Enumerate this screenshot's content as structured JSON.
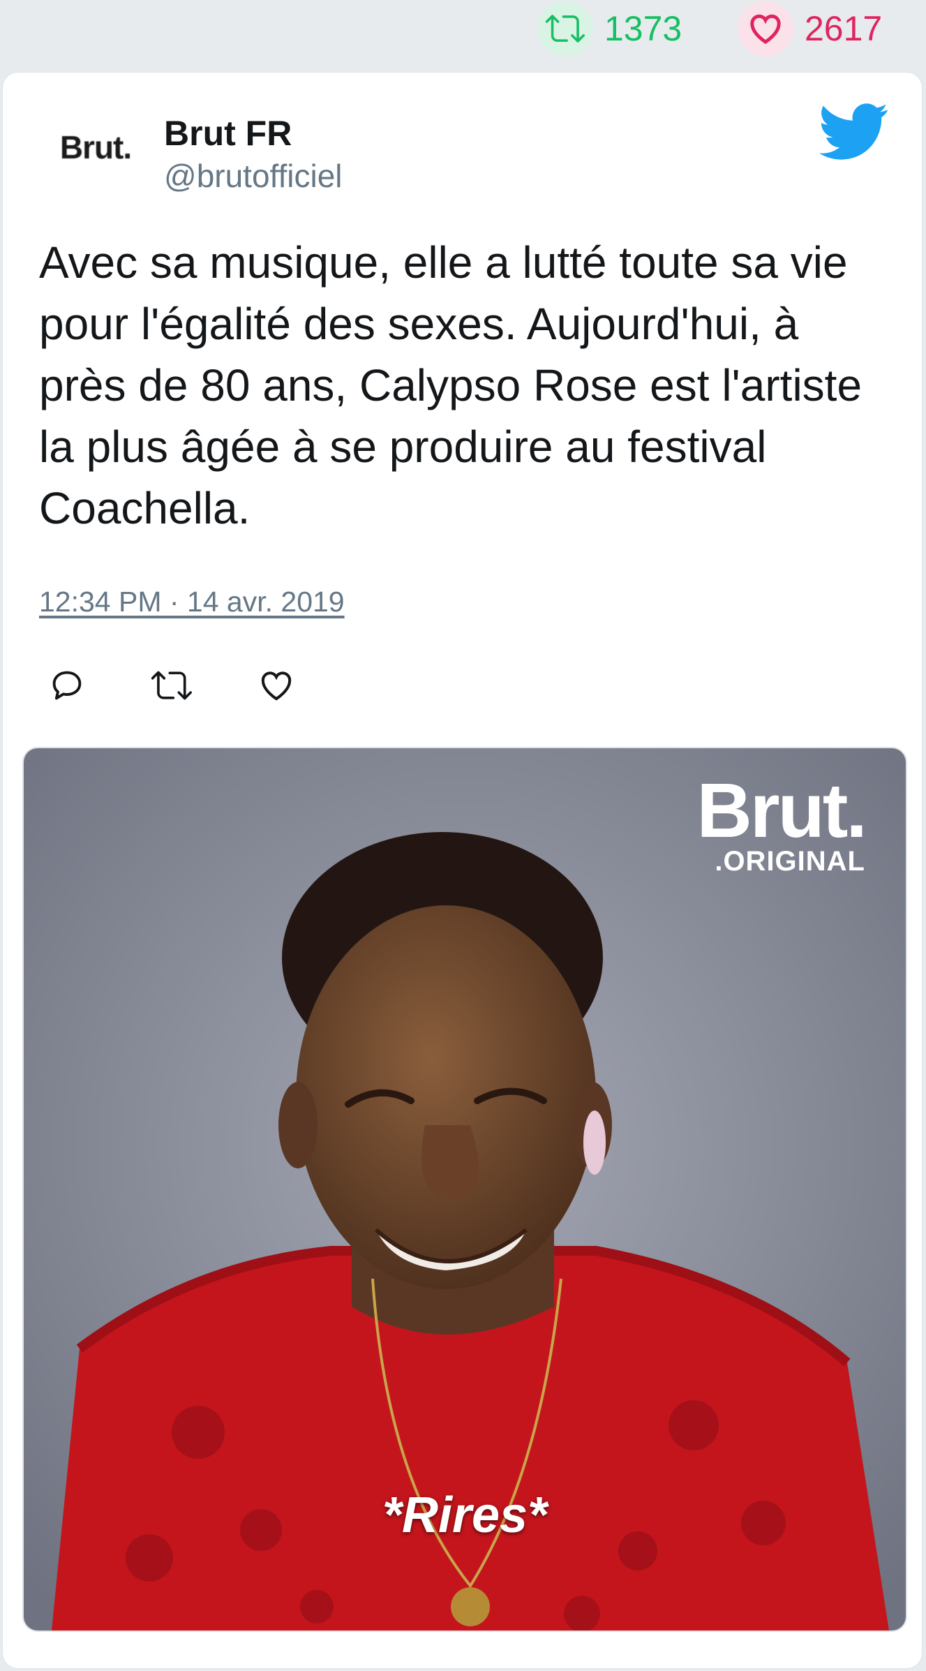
{
  "stats": {
    "retweets": "1373",
    "likes": "2617",
    "retweet_color": "#17bf63",
    "like_color": "#e0245e"
  },
  "author": {
    "avatar_logo": "Brut.",
    "name": "Brut FR",
    "handle": "@brutofficiel"
  },
  "tweet": {
    "text": "Avec sa musique, elle a lutté toute sa vie pour l'égalité des sexes. Aujourd'hui, à près de 80 ans, Calypso Rose est l'artiste la plus âgée à se produire au festival Coachella.",
    "timestamp": "12:34 PM · 14 avr. 2019"
  },
  "actions": [
    "reply-icon",
    "retweet-icon",
    "like-icon"
  ],
  "media": {
    "brand_main": "Brut.",
    "brand_sub": ".ORIGINAL",
    "caption": "*Rires*"
  },
  "colors": {
    "twitter_blue": "#1da1f2",
    "text": "#14171a",
    "muted": "#657786"
  }
}
